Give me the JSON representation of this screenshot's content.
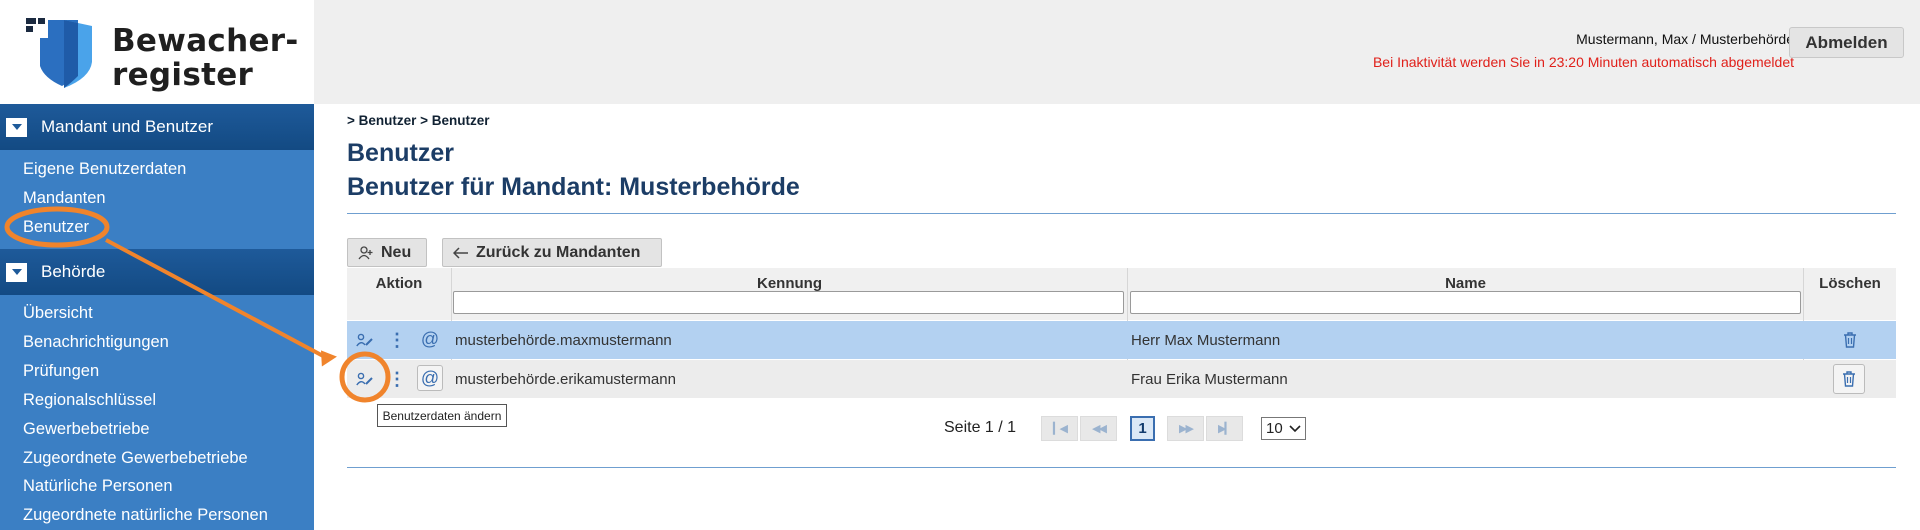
{
  "logo": {
    "line1": "Bewacher-",
    "line2": "register"
  },
  "header": {
    "user": "Mustermann, Max / Musterbehörde",
    "timeout": "Bei Inaktivität werden Sie in 23:20 Minuten automatisch abgemeldet",
    "logout_label": "Abmelden"
  },
  "sidebar": {
    "section1": "Mandant und Benutzer",
    "items1": [
      "Eigene Benutzerdaten",
      "Mandanten",
      "Benutzer"
    ],
    "section2": "Behörde",
    "items2": [
      "Übersicht",
      "Benachrichtigungen",
      "Prüfungen",
      "Regionalschlüssel",
      "Gewerbebetriebe",
      "Zugeordnete Gewerbebetriebe",
      "Natürliche Personen",
      "Zugeordnete natürliche Personen"
    ]
  },
  "main": {
    "breadcrumb": "> Benutzer > Benutzer",
    "title": "Benutzer",
    "subtitle": "Benutzer für Mandant: Musterbehörde",
    "new_label": "Neu",
    "back_label": "Zurück zu Mandanten"
  },
  "table": {
    "columns": [
      "Aktion",
      "Kennung",
      "Name",
      "Löschen"
    ],
    "rows": [
      {
        "kennung": "musterbehörde.maxmustermann",
        "name": "Herr Max Mustermann"
      },
      {
        "kennung": "musterbehörde.erikamustermann",
        "name": "Frau Erika Mustermann"
      }
    ]
  },
  "pager": {
    "label": "Seite 1 / 1",
    "current": "1",
    "page_size": "10"
  },
  "tooltip": "Benutzerdaten ändern",
  "colors": {
    "sidebar": "#3b7fc4",
    "section_header": "#1e5a9a",
    "highlight_row": "#b3d1f1",
    "annotation": "#f0842c",
    "warning": "#e0201a"
  }
}
